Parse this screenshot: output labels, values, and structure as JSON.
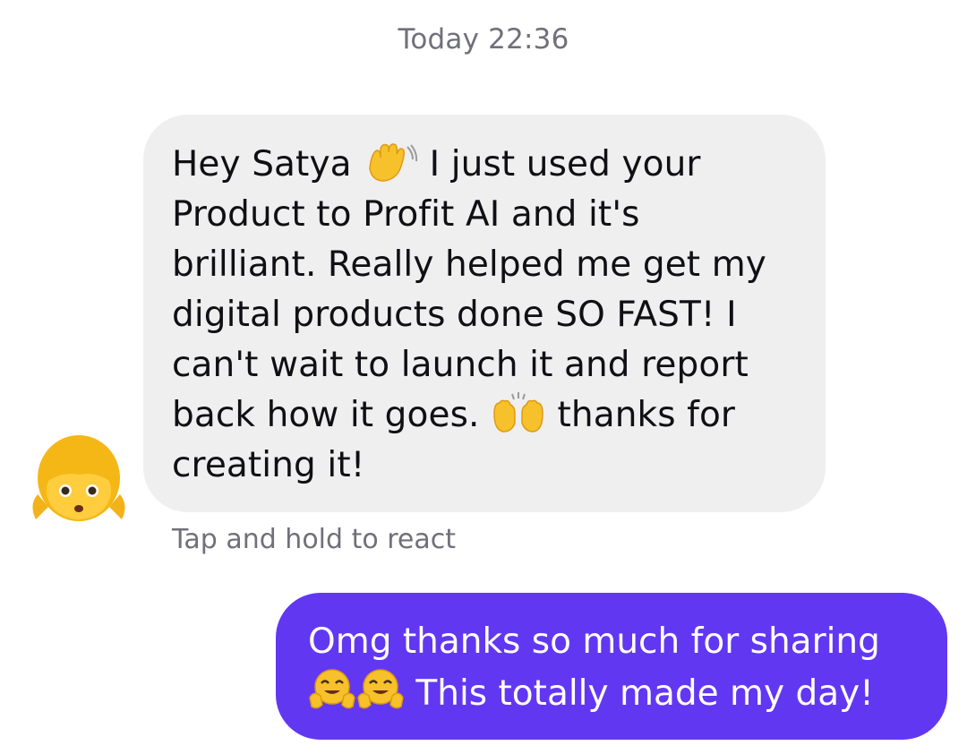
{
  "conversation": {
    "timestamp": "Today 22:36",
    "incoming": {
      "lines": [
        "Hey Satya",
        "I just used your",
        "Product to Profit AI and it's",
        "brilliant. Really helped me get my",
        "digital products done SO FAST! I",
        "can't wait to launch it and report",
        "back how it goes.",
        "thanks for",
        "creating it!"
      ],
      "emojis": [
        "waving-hand-emoji",
        "raising-hands-emoji"
      ],
      "avatar_icon": "girl-emoji-avatar",
      "bubble_color": "#efeff0"
    },
    "react_hint": "Tap and hold to react",
    "outgoing": {
      "lines": [
        "Omg thanks so much for sharing",
        "This totally made my day!"
      ],
      "emojis": [
        "hugging-face-emoji",
        "hugging-face-emoji"
      ],
      "bubble_color": "#6237f2",
      "text_color": "#ffffff"
    }
  }
}
